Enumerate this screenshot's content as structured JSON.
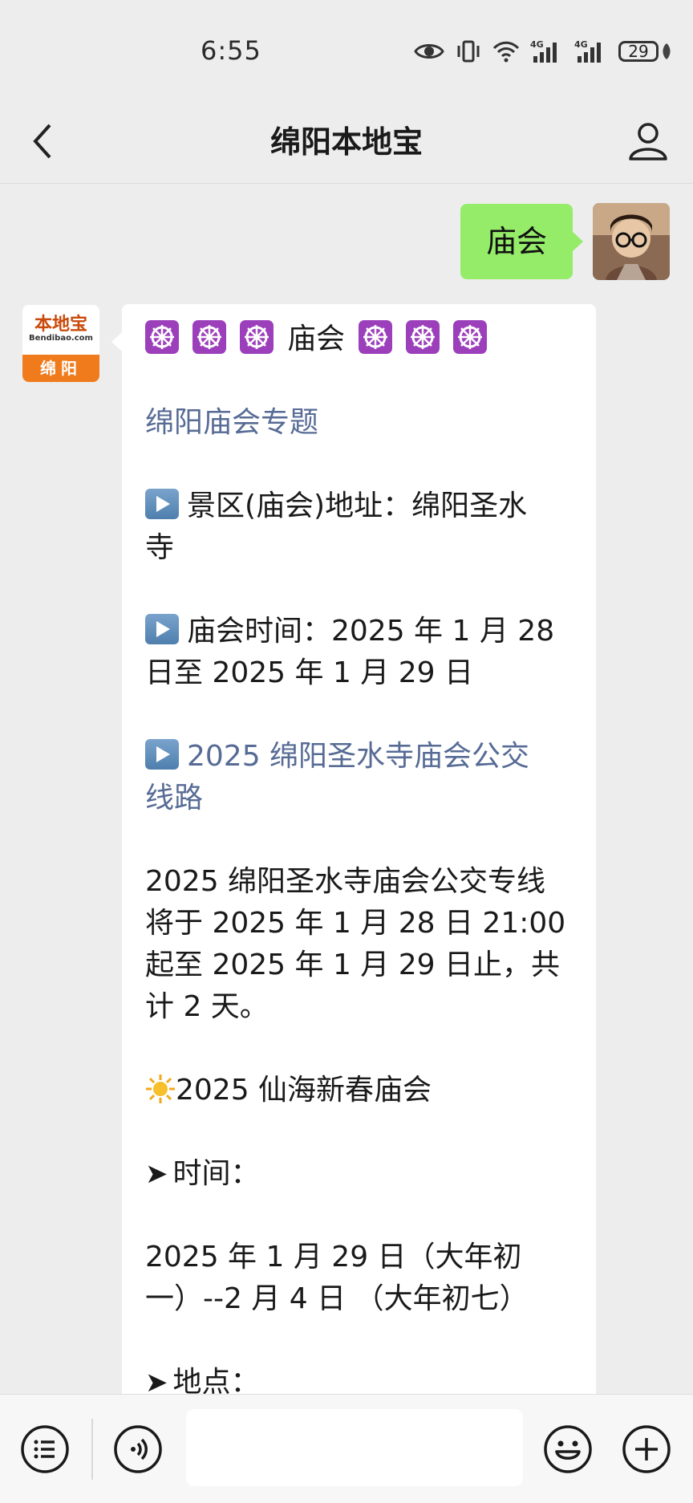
{
  "status_bar": {
    "time": "6:55",
    "network1": "4G",
    "network2": "4G",
    "battery": "29"
  },
  "header": {
    "title": "绵阳本地宝"
  },
  "messages": {
    "user_text": "庙会",
    "bot_avatar": {
      "brand": "本地宝",
      "url": "Bendibao.com",
      "city": "绵阳"
    },
    "bot": {
      "heading": "庙会",
      "topic_link": "绵阳庙会专题",
      "address_line1": "景区(庙会)地址：绵阳圣水",
      "address_line2": "寺",
      "time_line1": "庙会时间：2025 年 1 月 28",
      "time_line2": "日至 2025 年 1 月 29 日",
      "bus_link_line1": "2025 绵阳圣水寺庙会公交",
      "bus_link_line2": "线路",
      "para1_line1": "2025 绵阳圣水寺庙会公交专线",
      "para1_line2": "将于 2025 年 1 月 28 日 21:00",
      "para1_line3": "起至 2025 年 1 月 29 日止，共",
      "para1_line4": "计 2 天。",
      "event_title": "2025 仙海新春庙会",
      "time_label": "时间：",
      "date_line1": "2025 年 1 月 29 日（大年初",
      "date_line2": "一）--2 月 4 日 （大年初七）",
      "place_label": "地点："
    }
  },
  "input": {
    "placeholder": ""
  }
}
